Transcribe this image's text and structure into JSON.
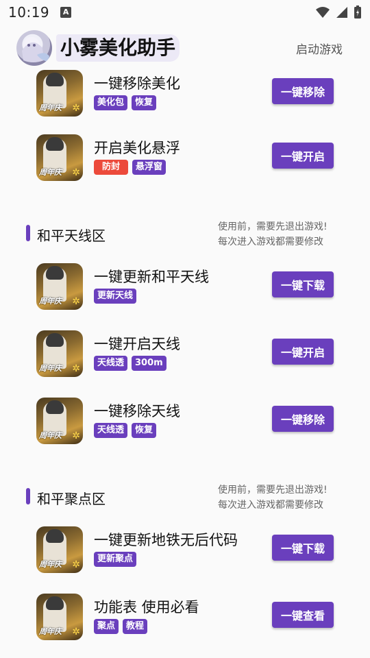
{
  "status_bar": {
    "time": "10:19",
    "notification_icon": "A"
  },
  "header": {
    "title": "小雾美化助手",
    "launch_label": "启动游戏"
  },
  "sections": [
    {
      "items": [
        {
          "title": "一键移除美化",
          "tags": [
            {
              "text": "美化包",
              "color": "#6a3fbd"
            },
            {
              "text": "恢复",
              "color": "#6a3fbd"
            }
          ],
          "button": "一键移除"
        },
        {
          "title": "开启美化悬浮",
          "tags": [
            {
              "text": "防封",
              "color": "#ec4a3b"
            },
            {
              "text": "悬浮窗",
              "color": "#6a3fbd"
            }
          ],
          "button": "一键开启"
        }
      ]
    },
    {
      "title": "和平天线区",
      "note_line1": "使用前，需要先退出游戏!",
      "note_line2": "每次进入游戏都需要修改",
      "items": [
        {
          "title": "一键更新和平天线",
          "tags": [
            {
              "text": "更新天线",
              "color": "#6a3fbd"
            }
          ],
          "button": "一键下载"
        },
        {
          "title": "一键开启天线",
          "tags": [
            {
              "text": "天线透",
              "color": "#6a3fbd"
            },
            {
              "text": "300m",
              "color": "#6a3fbd"
            }
          ],
          "button": "一键开启"
        },
        {
          "title": "一键移除天线",
          "tags": [
            {
              "text": "天线透",
              "color": "#6a3fbd"
            },
            {
              "text": "恢复",
              "color": "#6a3fbd"
            }
          ],
          "button": "一键移除"
        }
      ]
    },
    {
      "title": "和平聚点区",
      "note_line1": "使用前，需要先退出游戏!",
      "note_line2": "每次进入游戏都需要修改",
      "items": [
        {
          "title": "一键更新地铁无后代码",
          "tags": [
            {
              "text": "更新聚点",
              "color": "#6a3fbd"
            }
          ],
          "button": "一键下载"
        },
        {
          "title": "功能表 使用必看",
          "tags": [
            {
              "text": "聚点",
              "color": "#6a3fbd"
            },
            {
              "text": "教程",
              "color": "#6a3fbd"
            }
          ],
          "button": "一键查看"
        }
      ]
    }
  ],
  "game_icon_badge": "周年庆",
  "colors": {
    "accent": "#6a3fbd",
    "warning_tag": "#ec4a3b",
    "background": "#fafafa"
  }
}
